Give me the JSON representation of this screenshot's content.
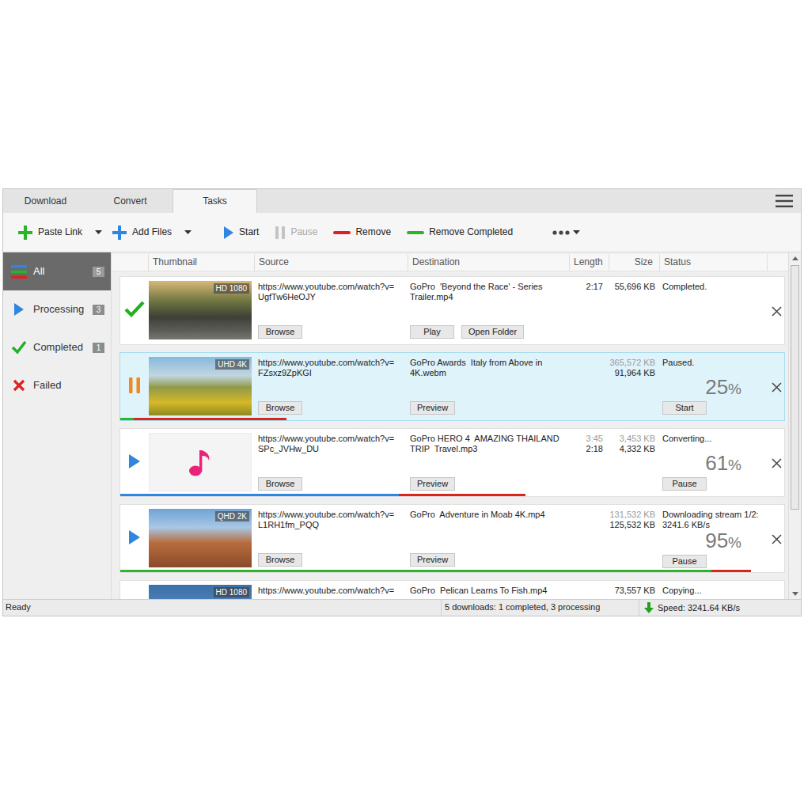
{
  "tabs": [
    {
      "label": "Download",
      "selected": false
    },
    {
      "label": "Convert",
      "selected": false
    },
    {
      "label": "Tasks",
      "selected": true
    }
  ],
  "toolbar": {
    "items": [
      {
        "label": "Paste Link",
        "kind": "plus",
        "color": "#2bb32b",
        "dropdown": true,
        "disabled": false
      },
      {
        "label": "Add Files",
        "kind": "plus",
        "color": "#2f86e0",
        "dropdown": true,
        "disabled": false
      },
      {
        "label": "Start",
        "kind": "play",
        "color": "#2f86e0",
        "dropdown": false,
        "disabled": false
      },
      {
        "label": "Pause",
        "kind": "pause",
        "color": "#c4c4c4",
        "dropdown": false,
        "disabled": true
      },
      {
        "label": "Remove",
        "kind": "dash",
        "color": "#e02020",
        "dropdown": false,
        "disabled": false
      },
      {
        "label": "Remove Completed",
        "kind": "dash",
        "color": "#2bb32b",
        "dropdown": false,
        "disabled": false
      }
    ],
    "more": {
      "dropdown": true
    }
  },
  "sidebar": {
    "items": [
      {
        "label": "All",
        "count": "5",
        "kind": "all",
        "selected": true
      },
      {
        "label": "Processing",
        "count": "3",
        "kind": "processing",
        "selected": false
      },
      {
        "label": "Completed",
        "count": "1",
        "kind": "completed",
        "selected": false
      },
      {
        "label": "Failed",
        "kind": "failed",
        "selected": false
      }
    ]
  },
  "table": {
    "columns": [
      "Thumbnail",
      "Source",
      "Destination",
      "Length",
      "Size",
      "Status"
    ],
    "rows": [
      {
        "state": "completed",
        "selected": false,
        "thumb": {
          "kind": "video",
          "badge": "HD 1080"
        },
        "source": "https://www.youtube.com/watch?v=UgfTw6HeOJY",
        "source_buttons": [
          "Browse"
        ],
        "destination": "GoPro  'Beyond the Race' - Series Trailer.mp4",
        "destination_buttons": [
          "Play",
          "Open Folder"
        ],
        "length": [
          {
            "text": "2:17",
            "muted": false
          }
        ],
        "size": [
          {
            "text": "55,696 KB",
            "muted": false
          }
        ],
        "status": [
          "Completed."
        ]
      },
      {
        "state": "paused",
        "selected": true,
        "thumb": {
          "kind": "video",
          "badge": "UHD 4K"
        },
        "source": "https://www.youtube.com/watch?v=FZsxz9ZpKGI",
        "source_buttons": [
          "Browse"
        ],
        "destination": "GoPro Awards  Italy from Above in 4K.webm",
        "destination_buttons": [
          "Preview"
        ],
        "length": [],
        "size": [
          {
            "text": "365,572 KB",
            "muted": true
          },
          {
            "text": "91,964 KB",
            "muted": false
          }
        ],
        "status": [
          "Paused."
        ],
        "percent": {
          "value": "25",
          "unit": "%"
        },
        "status_button": "Start",
        "progress": [
          {
            "level": 0.02,
            "color": "#2db52d"
          },
          {
            "level": 0.23,
            "color": "#d9261c"
          }
        ]
      },
      {
        "state": "processing",
        "selected": false,
        "thumb": {
          "kind": "audio"
        },
        "source": "https://www.youtube.com/watch?v=SPc_JVHw_DU",
        "source_buttons": [
          "Browse"
        ],
        "destination": "GoPro HERO 4  AMAZING THAILAND TRIP  Travel.mp3",
        "destination_buttons": [
          "Preview"
        ],
        "length": [
          {
            "text": "3:45",
            "muted": true
          },
          {
            "text": "2:18",
            "muted": false
          }
        ],
        "size": [
          {
            "text": "3,453 KB",
            "muted": true
          },
          {
            "text": "4,332 KB",
            "muted": false
          }
        ],
        "status": [
          "Converting..."
        ],
        "percent": {
          "value": "61",
          "unit": "%"
        },
        "status_button": "Pause",
        "progress": [
          {
            "level": 0.42,
            "color": "#2f86e0"
          },
          {
            "level": 0.19,
            "color": "#d9261c"
          }
        ]
      },
      {
        "state": "processing",
        "selected": false,
        "thumb": {
          "kind": "video",
          "badge": "QHD 2K"
        },
        "source": "https://www.youtube.com/watch?v=L1RH1fm_PQQ",
        "source_buttons": [
          "Browse"
        ],
        "destination": "GoPro  Adventure in Moab 4K.mp4",
        "destination_buttons": [
          "Preview"
        ],
        "length": [],
        "size": [
          {
            "text": "131,532 KB",
            "muted": true
          },
          {
            "text": "125,532 KB",
            "muted": false
          }
        ],
        "status": [
          "Downloading stream 1/2:",
          "3241.6 KB/s"
        ],
        "percent": {
          "value": "95",
          "unit": "%"
        },
        "status_button": "Pause",
        "progress": [
          {
            "level": 0.89,
            "color": "#2db52d"
          },
          {
            "level": 0.06,
            "color": "#d9261c"
          }
        ]
      },
      {
        "state": "processing",
        "selected": false,
        "thumb": {
          "kind": "video",
          "badge": "HD 1080"
        },
        "source": "https://www.youtube.com/watch?v=",
        "source_buttons": [],
        "destination": "GoPro  Pelican Learns To Fish.mp4",
        "destination_buttons": [],
        "length": [],
        "size": [
          {
            "text": "73,557 KB",
            "muted": false
          }
        ],
        "status": [
          "Copying..."
        ]
      }
    ]
  },
  "scrollbar": {
    "level": 0.76
  },
  "status_bar": {
    "text": "Ready",
    "summary": "5 downloads: 1 completed, 3 processing",
    "speed": "Speed: 3241.64 KB/s"
  }
}
